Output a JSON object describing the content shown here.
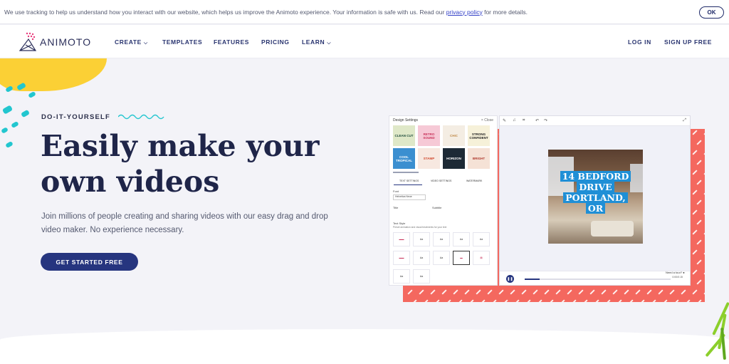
{
  "cookie": {
    "text_before": "We use tracking to help us understand how you interact with our website, which helps us improve the Animoto experience. Your information is safe with us. Read our ",
    "link": "privacy policy",
    "text_after": " for more details.",
    "ok": "OK"
  },
  "nav": {
    "logo": "ANIMOTO",
    "create": "CREATE",
    "templates": "TEMPLATES",
    "features": "FEATURES",
    "pricing": "PRICING",
    "learn": "LEARN",
    "login": "LOG IN",
    "signup": "SIGN UP FREE"
  },
  "hero": {
    "eyebrow": "DO-IT-YOURSELF",
    "headline_line1": "Easily make your",
    "headline_line2": "own videos",
    "subtext": "Join millions of people creating and sharing videos with our easy drag and drop video maker. No experience necessary.",
    "cta": "GET STARTED FREE"
  },
  "editor": {
    "panel_title": "Design Settings",
    "panel_close": "Close",
    "tiles": [
      {
        "label": "CLEAN CUT",
        "bg": "#dfe8c8",
        "fg": "#1c4a3a"
      },
      {
        "label": "RETRO SOUND",
        "bg": "#f6c9d6",
        "fg": "#c8325a"
      },
      {
        "label": "CHIC",
        "bg": "#f4ede3",
        "fg": "#c08a4a"
      },
      {
        "label": "STRONG CONFIDENT",
        "bg": "#f6f1d9",
        "fg": "#222"
      },
      {
        "label": "COOL TROPICAL",
        "bg": "#3b8fd0",
        "fg": "#fff"
      },
      {
        "label": "STAMP",
        "bg": "#f7e8e0",
        "fg": "#d1492e"
      },
      {
        "label": "HORIZON",
        "bg": "#1d2a36",
        "fg": "#fff"
      },
      {
        "label": "BRIGHT",
        "bg": "#f5e2d6",
        "fg": "#b03a2e"
      }
    ],
    "tabs": [
      "TEXT SETTINGS",
      "VIDEO SETTINGS",
      "WATERMARK"
    ],
    "font_label": "Font",
    "font_value": "Helvetica Neue",
    "title_label": "Title",
    "subtitle_label": "Subtitle",
    "text_style_label": "Text Style",
    "text_style_desc": "Preset animation and visual treatments for your text",
    "video_caption": "14 BEDFORD DRIVE PORTLAND, OR",
    "caption_lines": [
      "14 BEDFORD",
      "DRIVE",
      "PORTLAND,",
      "OR"
    ],
    "help": "Need a tour?",
    "time": "0:00/0:15",
    "progress": 0.1
  }
}
